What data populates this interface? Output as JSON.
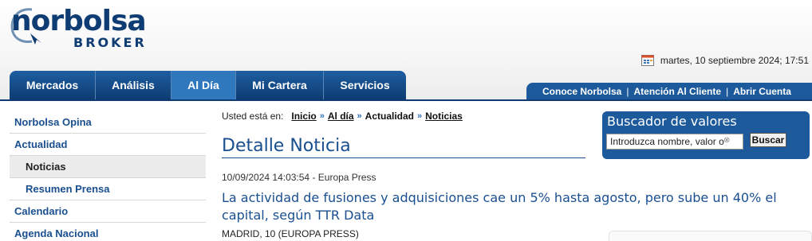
{
  "brand": {
    "name": "norbolsa",
    "sub": "BROKER"
  },
  "header": {
    "date": "martes, 10 septiembre 2024; 17:51"
  },
  "main_nav": {
    "tabs": [
      {
        "label": "Mercados"
      },
      {
        "label": "Análisis"
      },
      {
        "label": "Al Día"
      },
      {
        "label": "Mi Cartera"
      },
      {
        "label": "Servicios"
      }
    ]
  },
  "secondary_nav": {
    "links": [
      {
        "label": "Conoce Norbolsa"
      },
      {
        "label": "Atención Al Cliente"
      },
      {
        "label": "Abrir Cuenta"
      }
    ],
    "separator": "|"
  },
  "sidebar": {
    "items": [
      {
        "label": "Norbolsa Opina"
      },
      {
        "label": "Actualidad"
      },
      {
        "label": "Noticias"
      },
      {
        "label": "Resumen Prensa"
      },
      {
        "label": "Calendario"
      },
      {
        "label": "Agenda Nacional"
      }
    ]
  },
  "breadcrumb": {
    "label": "Usted está en:",
    "items": [
      {
        "label": "Inicio"
      },
      {
        "label": "Al día"
      },
      {
        "label": "Actualidad"
      },
      {
        "label": "Noticias"
      }
    ]
  },
  "article": {
    "section_title": "Detalle Noticia",
    "meta": "10/09/2024 14:03:54 - Europa Press",
    "headline": "La actividad de fusiones y adquisiciones cae un 5% hasta agosto, pero sube un 40% el capital, según TTR Data",
    "location": "MADRID, 10 (EUROPA PRESS)"
  },
  "search": {
    "title": "Buscador de valores",
    "value": "Introduzca nombre, valor o",
    "button": "Buscar"
  },
  "colors": {
    "brand_blue": "#0f3d73",
    "nav_blue": "#1c5a9c",
    "link_blue": "#1a4f8f"
  }
}
